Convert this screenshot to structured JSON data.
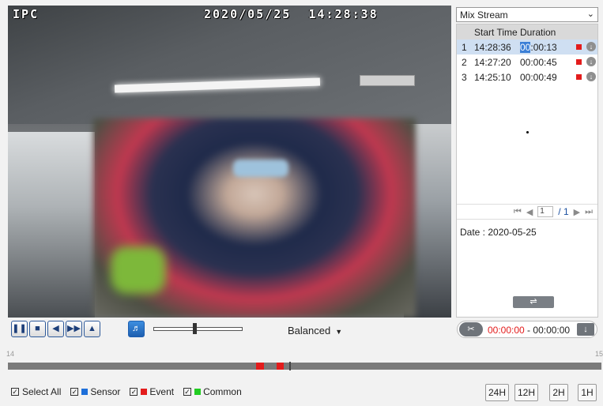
{
  "video": {
    "camera_name": "IPC",
    "timestamp": "2020/05/25  14:28:38"
  },
  "stream": {
    "selected": "Mix Stream"
  },
  "records": {
    "headers": [
      "Start Time",
      "Duration"
    ],
    "rows": [
      {
        "index": "1",
        "start": "14:28:36",
        "duration_highlight": "00",
        "duration_rest": ":00:13",
        "selected": true
      },
      {
        "index": "2",
        "start": "14:27:20",
        "duration_highlight": "",
        "duration_rest": "00:00:45",
        "selected": false
      },
      {
        "index": "3",
        "start": "14:25:10",
        "duration_highlight": "",
        "duration_rest": "00:00:49",
        "selected": false
      }
    ],
    "type_color": "#e31c1c"
  },
  "pager": {
    "current": "1",
    "total": "/ 1"
  },
  "date_line": "Date : 2020-05-25",
  "controls": {
    "quality": "Balanced"
  },
  "clip": {
    "start": "00:00:00",
    "separator": " - ",
    "end": "00:00:00"
  },
  "timeline": {
    "left_label": "14",
    "right_label": "15",
    "event_color": "#e31c1c"
  },
  "legend": {
    "select_all": "Select All",
    "sensor": "Sensor",
    "event": "Event",
    "common": "Common",
    "sensor_color": "#1e6fd9",
    "event_color": "#e31c1c",
    "common_color": "#22cc22"
  },
  "zoom": [
    "24H",
    "12H",
    "2H",
    "1H"
  ]
}
